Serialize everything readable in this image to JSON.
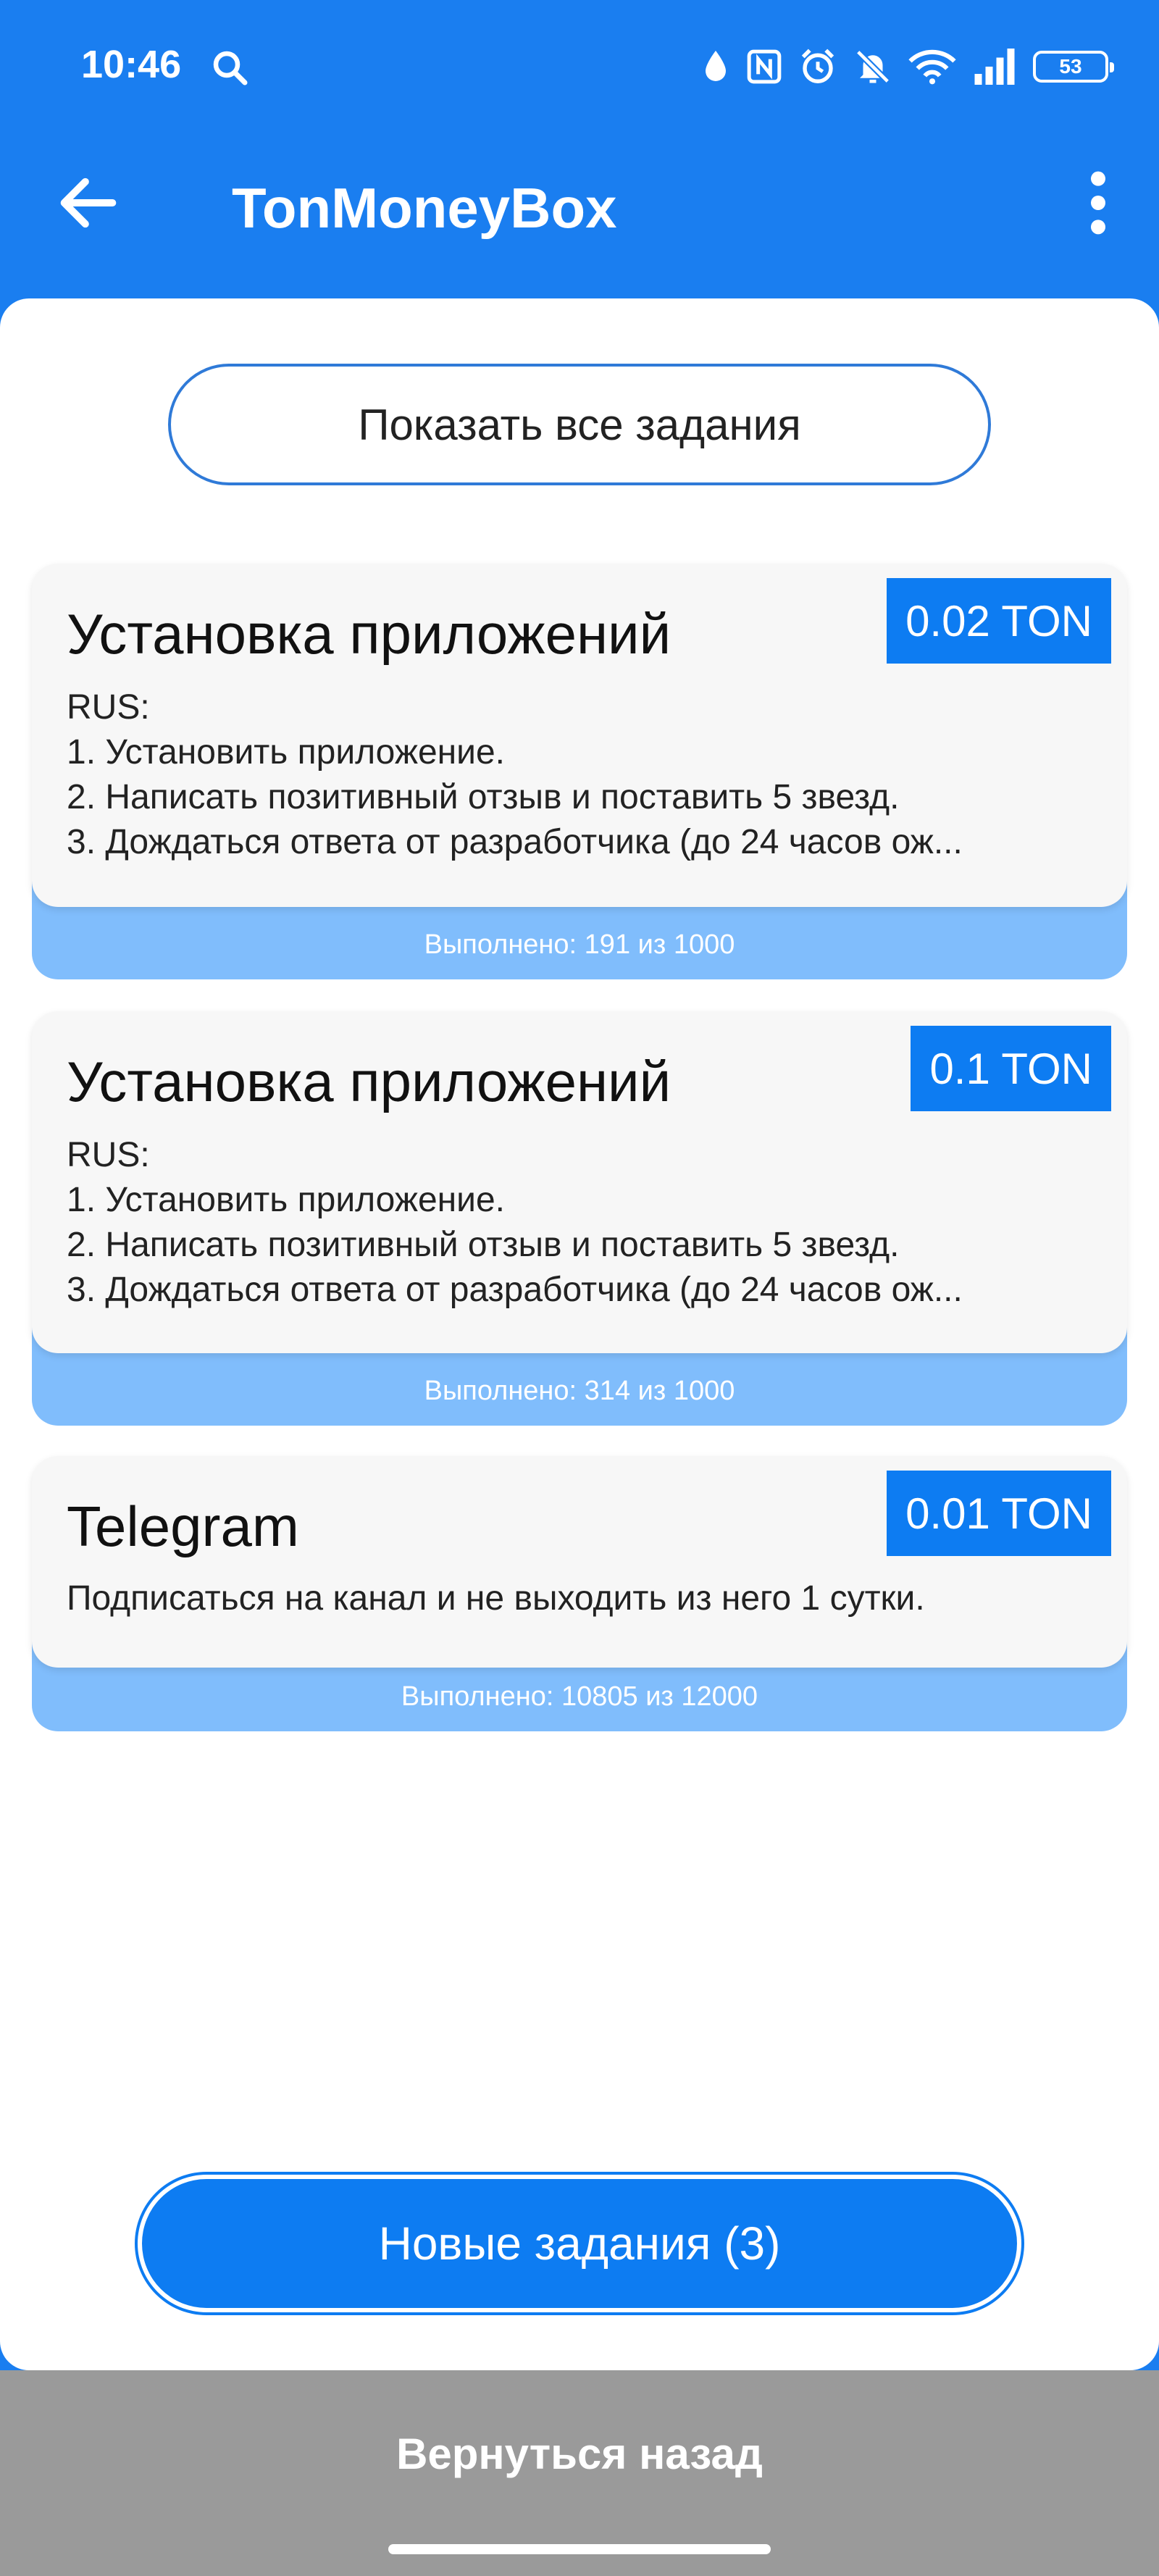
{
  "status_bar": {
    "time": "10:46",
    "battery": "53",
    "icons": [
      "search-icon",
      "drop-icon",
      "nfc-icon",
      "alarm-icon",
      "mute-icon",
      "wifi-icon",
      "signal-icon",
      "battery-icon"
    ]
  },
  "app_bar": {
    "title": "TonMoneyBox",
    "icons": [
      "arrow-left-icon",
      "more-vert-icon"
    ]
  },
  "show_all_label": "Показать все задания",
  "tasks": [
    {
      "title": "Установка приложений",
      "reward": "0.02 TON",
      "description": "RUS:\n1. Установить приложение.\n2. Написать позитивный отзыв и поставить 5 звезд.\n3. Дождаться ответа от разработчика (до 24 часов ож...",
      "progress": "Выполнено: 191 из 1000"
    },
    {
      "title": "Установка приложений",
      "reward": "0.1 TON",
      "description": "RUS:\n1. Установить приложение.\n2. Написать позитивный отзыв и поставить 5 звезд.\n3. Дождаться ответа от разработчика (до 24 часов ож...",
      "progress": "Выполнено: 314 из 1000"
    },
    {
      "title": "Telegram",
      "reward": "0.01 TON",
      "description": "Подписаться на канал и не выходить из него 1 сутки.",
      "progress": "Выполнено: 10805 из 12000"
    }
  ],
  "new_tasks_label": "Новые задания (3)",
  "go_back_label": "Вернуться назад",
  "colors": {
    "primary": "#1a7ef0",
    "badge": "#0d7cf2",
    "footer": "#80bdfc",
    "bottom_bar": "#9a9a9a"
  }
}
